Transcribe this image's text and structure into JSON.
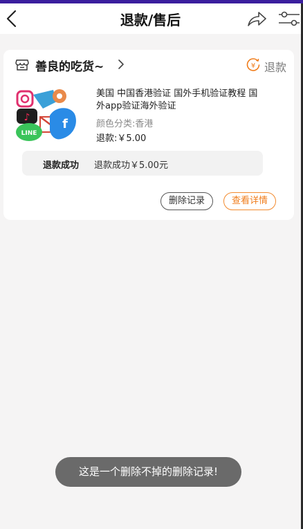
{
  "header": {
    "title": "退款/售后"
  },
  "shop": {
    "name": "善良的吃货~",
    "refund_tag": "退款",
    "refund_icon_glyph": "¥"
  },
  "product": {
    "title": "美国 中国香港验证 国外手机验证教程 国外app验证海外验证",
    "variant": "颜色分类:香港",
    "refund_amount": "退款:￥5.00",
    "image_badge_text": "LINE"
  },
  "status": {
    "label": "退款成功",
    "text": "退款成功￥5.00元"
  },
  "actions": {
    "delete_label": "删除记录",
    "detail_label": "查看详情"
  },
  "toast": {
    "message": "这是一个删除不掉的删除记录!"
  },
  "colors": {
    "accent_orange": "#f07c1a",
    "top_strip": "#3b1f9e",
    "toast_bg": "#6a6a6a"
  }
}
